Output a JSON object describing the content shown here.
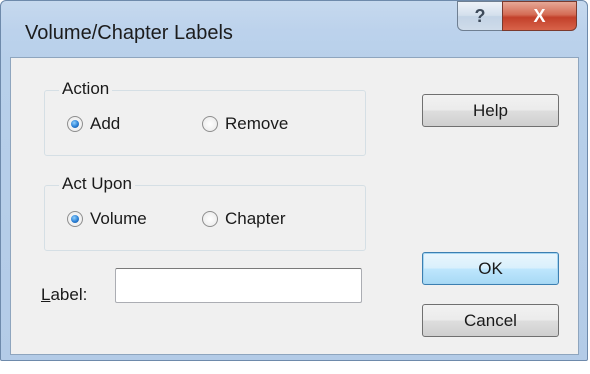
{
  "window": {
    "title": "Volume/Chapter Labels",
    "caption_help_icon": "?",
    "caption_close_icon": "X"
  },
  "action_group": {
    "legend": "Action",
    "options": [
      {
        "label": "Add",
        "checked": true
      },
      {
        "label": "Remove",
        "checked": false
      }
    ]
  },
  "act_upon_group": {
    "legend": "Act Upon",
    "options": [
      {
        "label": "Volume",
        "checked": true
      },
      {
        "label": "Chapter",
        "checked": false
      }
    ]
  },
  "label_field": {
    "label_mnemonic": "L",
    "label_rest": "abel:",
    "value": "",
    "placeholder": ""
  },
  "buttons": {
    "help": "Help",
    "ok": "OK",
    "cancel": "Cancel"
  }
}
